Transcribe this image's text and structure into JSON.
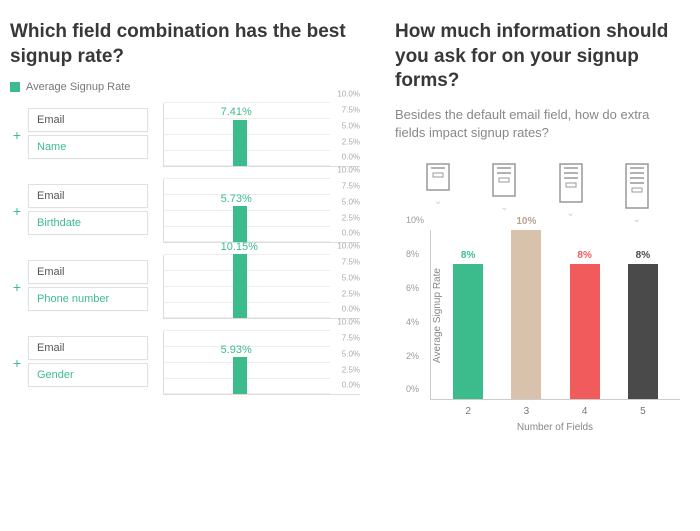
{
  "left": {
    "title": "Which field combination has the best signup rate?",
    "legend": "Average Signup Rate",
    "emailLabel": "Email",
    "combos": [
      {
        "extra": "Name",
        "value": 7.41,
        "label": "7.41%"
      },
      {
        "extra": "Birthdate",
        "value": 5.73,
        "label": "5.73%"
      },
      {
        "extra": "Phone number",
        "value": 10.15,
        "label": "10.15%"
      },
      {
        "extra": "Gender",
        "value": 5.93,
        "label": "5.93%"
      }
    ],
    "ticks": [
      0,
      2.5,
      5,
      7.5,
      10
    ]
  },
  "right": {
    "title": "How much information should you ask for on your signup forms?",
    "subtitle": "Besides the default email field, how do extra fields impact signup rates?",
    "ylabel": "Average Signup Rate",
    "xlabel": "Number of Fields",
    "ymax": 10,
    "yticks": [
      0,
      2,
      4,
      6,
      8,
      10
    ],
    "bars": [
      {
        "x": "2",
        "value": 8,
        "label": "8%",
        "color": "#3cbc8d",
        "labelColor": "#3cbc8d"
      },
      {
        "x": "3",
        "value": 10,
        "label": "10%",
        "color": "#d8c2ab",
        "labelColor": "#b8a58e"
      },
      {
        "x": "4",
        "value": 8,
        "label": "8%",
        "color": "#f25b5b",
        "labelColor": "#f25b5b"
      },
      {
        "x": "5",
        "value": 8,
        "label": "8%",
        "color": "#4a4a4a",
        "labelColor": "#4a4a4a"
      }
    ],
    "formLines": [
      2,
      3,
      4,
      5
    ]
  },
  "chart_data": [
    {
      "type": "bar",
      "title": "Which field combination has the best signup rate?",
      "ylabel": "Average Signup Rate",
      "ylim": [
        0,
        10
      ],
      "categories": [
        "Email+Name",
        "Email+Birthdate",
        "Email+Phone number",
        "Email+Gender"
      ],
      "values": [
        7.41,
        5.73,
        10.15,
        5.93
      ]
    },
    {
      "type": "bar",
      "title": "How much information should you ask for on your signup forms?",
      "xlabel": "Number of Fields",
      "ylabel": "Average Signup Rate",
      "ylim": [
        0,
        10
      ],
      "categories": [
        "2",
        "3",
        "4",
        "5"
      ],
      "values": [
        8,
        10,
        8,
        8
      ]
    }
  ]
}
